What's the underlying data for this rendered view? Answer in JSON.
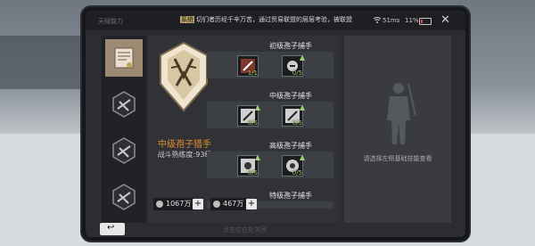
{
  "statusbar": {
    "title": "天赋能力",
    "news_tag": "系统",
    "news_text": "切们者历经千辛万苦，通过贸易联盟的层层考验，被联盟",
    "ping": "51ms",
    "battery": "11%"
  },
  "left_tabs": [
    {
      "name": "tab-skill-1",
      "icon": "certificate-icon",
      "active": true
    },
    {
      "name": "tab-skill-2",
      "icon": "badge-icon",
      "active": false
    },
    {
      "name": "tab-skill-3",
      "icon": "badge-icon",
      "active": false
    },
    {
      "name": "tab-skill-4",
      "icon": "badge-icon",
      "active": false
    }
  ],
  "rank": {
    "name": "中级孢子猎手",
    "mastery": "战斗熟练度:93级"
  },
  "tiers": [
    {
      "title": "初级孢子捕手",
      "slots": [
        {
          "count": "1/1"
        },
        {
          "count": "0/5"
        }
      ]
    },
    {
      "title": "中级孢子捕手",
      "slots": [
        {
          "count": "0/5"
        },
        {
          "count": "0/5"
        }
      ]
    },
    {
      "title": "高级孢子捕手",
      "slots": [
        {
          "count": "0/5"
        },
        {
          "count": "0/5"
        }
      ]
    },
    {
      "title": "特级孢子捕手",
      "slots": []
    }
  ],
  "currency": [
    {
      "value": "1067万",
      "icon": "coin-icon"
    },
    {
      "value": "467万",
      "icon": "gem-icon"
    }
  ],
  "right_panel": {
    "hint": "请选择左侧基础技能查看"
  },
  "footer": {
    "note": "点击空白处关闭"
  },
  "colors": {
    "accent": "#e28b2f",
    "count_green": "#9dd26a"
  }
}
